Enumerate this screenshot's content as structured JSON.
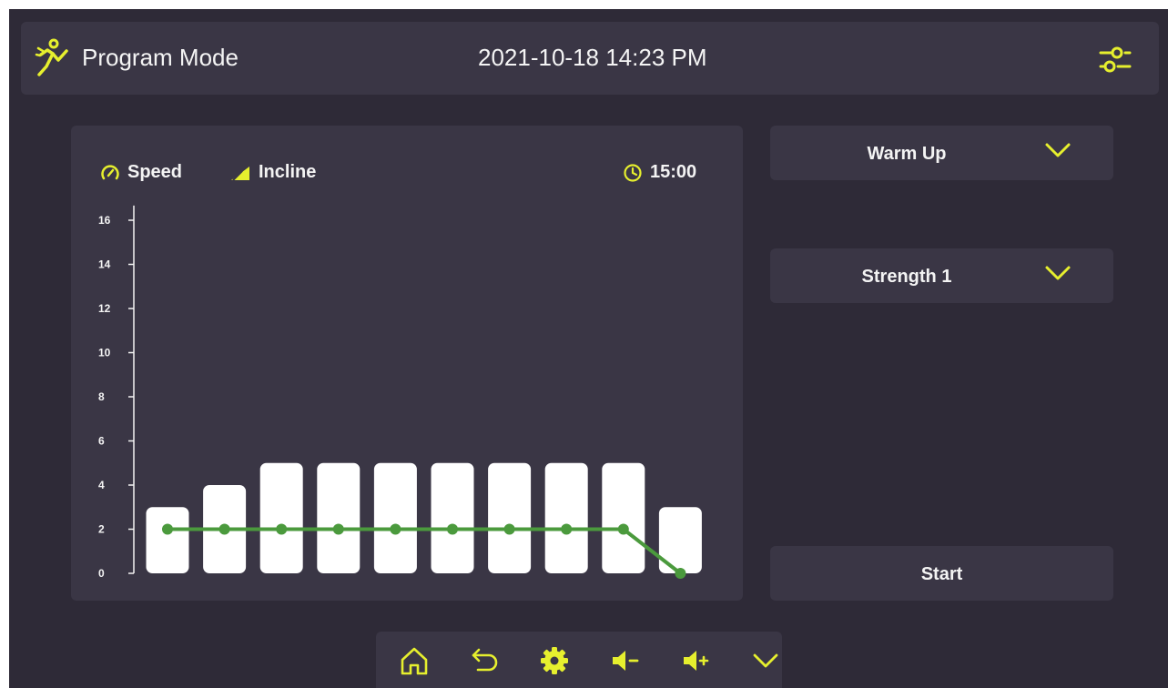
{
  "header": {
    "title": "Program Mode",
    "datetime": "2021-10-18 14:23 PM",
    "runner_icon": "running-person-icon",
    "settings_icon": "sliders-icon"
  },
  "legend": {
    "speed_label": "Speed",
    "incline_label": "Incline",
    "time": "15:00"
  },
  "controls": {
    "program_select": "Warm Up",
    "level_select": "Strength 1",
    "start_label": "Start"
  },
  "bottom_nav": [
    "home-icon",
    "back-icon",
    "gear-icon",
    "volume-down-icon",
    "volume-up-icon",
    "chevron-down-icon"
  ],
  "colors": {
    "accent": "#e6ef2e",
    "speed_line": "#4b9a3d",
    "background": "#2e2a37",
    "panel": "#3a3645"
  },
  "chart_data": {
    "type": "bar",
    "y_ticks": [
      "0",
      "2",
      "4",
      "6",
      "8",
      "10",
      "12",
      "14",
      "16"
    ],
    "ylim": [
      0,
      16.5
    ],
    "series": [
      {
        "name": "Incline",
        "type": "bar",
        "values": [
          3,
          4,
          5,
          5,
          5,
          5,
          5,
          5,
          5,
          3
        ]
      },
      {
        "name": "Speed",
        "type": "line",
        "values": [
          2,
          2,
          2,
          2,
          2,
          2,
          2,
          2,
          2,
          0
        ]
      }
    ]
  }
}
